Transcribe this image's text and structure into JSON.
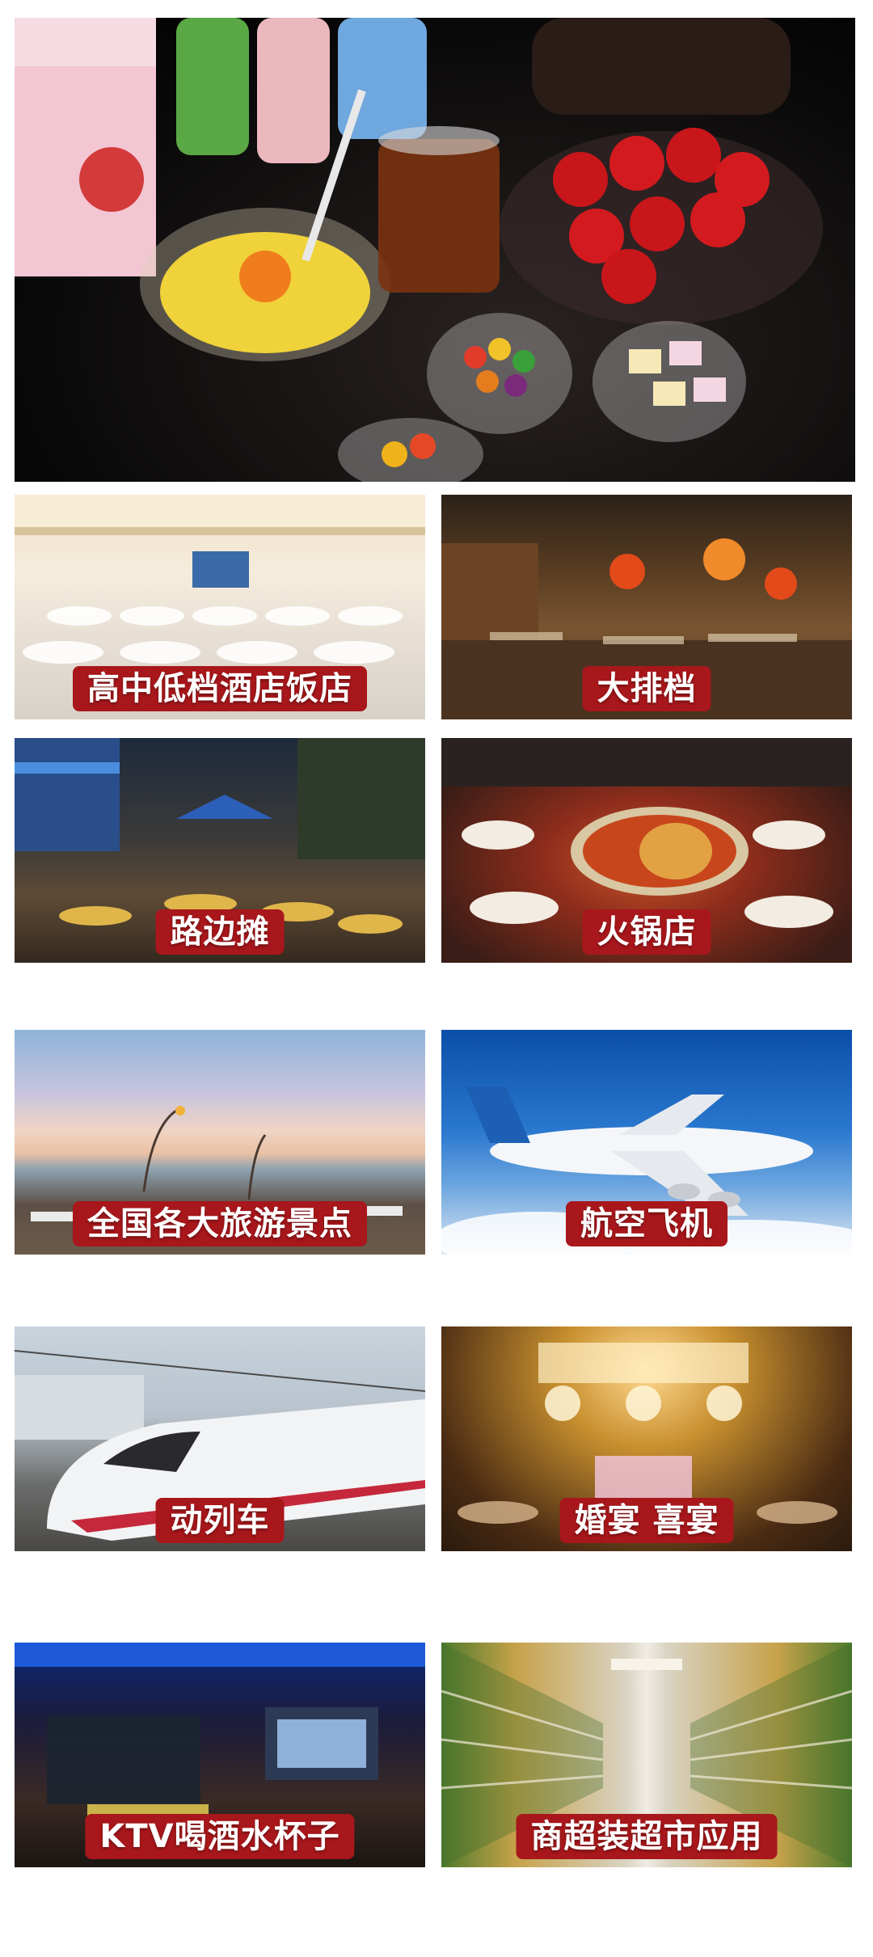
{
  "tiles": [
    {
      "label": "高中低档酒店饭店"
    },
    {
      "label": "大排档"
    },
    {
      "label": "路边摊"
    },
    {
      "label": "火锅店"
    },
    {
      "label": "全国各大旅游景点"
    },
    {
      "label": "航空飞机"
    },
    {
      "label": "动列车"
    },
    {
      "label": "婚宴 喜宴"
    },
    {
      "label": "KTV喝酒水杯子"
    },
    {
      "label": "商超装超市应用"
    }
  ],
  "colors": {
    "label_background": "#a8171b",
    "label_text": "#ffffff",
    "page_background": "#ffffff"
  }
}
